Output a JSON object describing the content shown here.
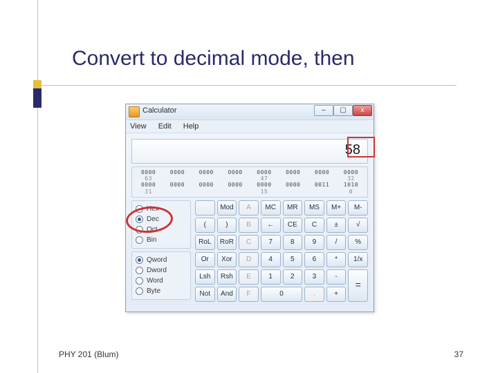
{
  "slide": {
    "title": "Convert to decimal mode, then",
    "footer_left": "PHY 201 (Blum)",
    "footer_right": "37"
  },
  "calc": {
    "app_title": "Calculator",
    "win_min": "–",
    "win_max": "▢",
    "win_close": "x",
    "menu": {
      "view": "View",
      "edit": "Edit",
      "help": "Help"
    },
    "display_value": "58",
    "bits": {
      "row1": [
        "0000",
        "0000",
        "0000",
        "0000",
        "0000",
        "0000",
        "0000",
        "0000"
      ],
      "idx1": [
        "63",
        "",
        "",
        "",
        "47",
        "",
        "",
        "32"
      ],
      "row2": [
        "0000",
        "0000",
        "0000",
        "0000",
        "0000",
        "0000",
        "0011",
        "1010"
      ],
      "idx2": [
        "31",
        "",
        "",
        "",
        "15",
        "",
        "",
        "0"
      ]
    },
    "radios_base": [
      {
        "label": "Hex",
        "checked": false
      },
      {
        "label": "Dec",
        "checked": true
      },
      {
        "label": "Oct",
        "checked": false
      },
      {
        "label": "Bin",
        "checked": false
      }
    ],
    "radios_word": [
      {
        "label": "Qword",
        "checked": true
      },
      {
        "label": "Dword",
        "checked": false
      },
      {
        "label": "Word",
        "checked": false
      },
      {
        "label": "Byte",
        "checked": false
      }
    ],
    "btns": {
      "r0": [
        "",
        "Mod",
        "A",
        "MC",
        "MR",
        "MS",
        "M+",
        "M-"
      ],
      "r1": [
        "(",
        ")",
        "B",
        "←",
        "CE",
        "C",
        "±",
        "√"
      ],
      "r2": [
        "RoL",
        "RoR",
        "C",
        "7",
        "8",
        "9",
        "/",
        "%"
      ],
      "r3": [
        "Or",
        "Xor",
        "D",
        "4",
        "5",
        "6",
        "*",
        "1/x"
      ],
      "r4": [
        "Lsh",
        "Rsh",
        "E",
        "1",
        "2",
        "3",
        "-",
        "="
      ],
      "r5": [
        "Not",
        "And",
        "F",
        "0",
        ".",
        "+"
      ]
    }
  }
}
